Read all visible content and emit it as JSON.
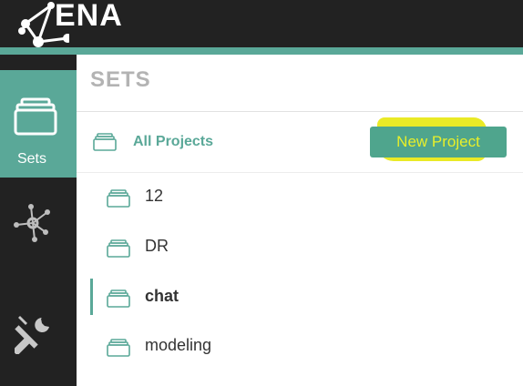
{
  "app": {
    "logo_text": "ENA"
  },
  "nav": {
    "items": [
      {
        "label": "Sets",
        "icon": "folder-icon",
        "active": true
      },
      {
        "label": "",
        "icon": "network-icon",
        "active": false
      },
      {
        "label": "",
        "icon": "tools-icon",
        "active": false
      }
    ]
  },
  "main": {
    "title": "SETS",
    "all_projects_label": "All Projects",
    "new_project_label": "New Project",
    "sets": [
      {
        "label": "12",
        "active": false
      },
      {
        "label": "DR",
        "active": false
      },
      {
        "label": "chat",
        "active": true
      },
      {
        "label": "modeling",
        "active": false
      }
    ]
  },
  "colors": {
    "accent": "#5aa898",
    "topbar": "#222222",
    "button": "#4fa58d",
    "highlight": "#e6e600",
    "title_gray": "#b3b3b3"
  }
}
